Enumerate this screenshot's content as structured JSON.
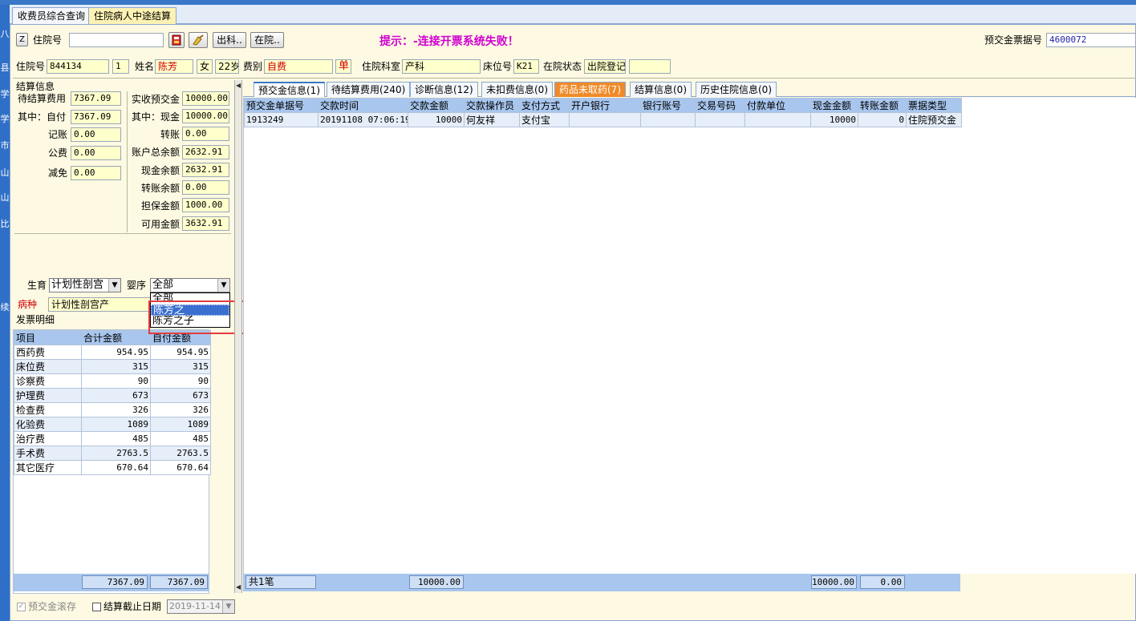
{
  "window_tabs": [
    "收费员综合查询",
    "住院病人中途结算"
  ],
  "left_strip": [
    "八",
    "县",
    "学",
    "学",
    "市",
    "山",
    "山",
    "比",
    "续"
  ],
  "search": {
    "z_label": "Z",
    "inpatient_label": "住院号",
    "inpatient_value": "",
    "discharge_btn": "出科..",
    "inhospital_btn": "在院..",
    "hint": "提示：-连接开票系统失败！",
    "prepay_receipt_label": "预交金票据号",
    "prepay_receipt_value": "4600072"
  },
  "patient": {
    "id_label": "住院号",
    "id_value": "844134",
    "seq": "1",
    "name_label": "姓名",
    "name": "陈芳",
    "sex": "女",
    "age": "22岁",
    "fee_type_label": "费别",
    "fee_type": "自费",
    "single_badge": "单",
    "dept_label": "住院科室",
    "dept": "产科",
    "bed_label": "床位号",
    "bed": "K21",
    "status_label": "在院状态",
    "status": "出院登记",
    "extra": ""
  },
  "settlement": {
    "title": "结算信息",
    "pending_fee_label": "待结算费用",
    "pending_fee": "7367.09",
    "self_pay_label": "其中：自付",
    "self_pay": "7367.09",
    "account_label": "记账",
    "account": "0.00",
    "public_label": "公费",
    "public": "0.00",
    "discount_label": "减免",
    "discount": "0.00",
    "received_prepay_label": "实收预交金",
    "received_prepay": "10000.00",
    "cash_label": "其中：现金",
    "cash": "10000.00",
    "transfer_label": "转账",
    "transfer": "0.00",
    "total_balance_label": "账户总余额",
    "total_balance": "2632.91",
    "cash_balance_label": "现金余额",
    "cash_balance": "2632.91",
    "transfer_balance_label": "转账余额",
    "transfer_balance": "0.00",
    "guarantee_label": "担保金额",
    "guarantee": "1000.00",
    "available_label": "可用金额",
    "available": "3632.91"
  },
  "birth": {
    "label": "生育",
    "value": "计划性剖宫",
    "baby_label": "婴序",
    "baby_value": "全部",
    "baby_options": [
      "全部",
      "陈芳之",
      "陈芳之子"
    ],
    "disease_label": "病种",
    "disease_value": "计划性剖宫产"
  },
  "invoice": {
    "title": "发票明细",
    "columns": [
      "项目",
      "合计金额",
      "自付金额"
    ],
    "rows": [
      [
        "西药费",
        "954.95",
        "954.95"
      ],
      [
        "床位费",
        "315",
        "315"
      ],
      [
        "诊察费",
        "90",
        "90"
      ],
      [
        "护理费",
        "673",
        "673"
      ],
      [
        "检查费",
        "326",
        "326"
      ],
      [
        "化验费",
        "1089",
        "1089"
      ],
      [
        "治疗费",
        "485",
        "485"
      ],
      [
        "手术费",
        "2763.5",
        "2763.5"
      ],
      [
        "其它医疗",
        "670.64",
        "670.64"
      ]
    ],
    "total": "7367.09",
    "self_total": "7367.09"
  },
  "subtabs": [
    "预交金信息(1)",
    "待结算费用(240)",
    "诊断信息(12)",
    "未扣费信息(0)",
    "药品未取药(7)",
    "结算信息(0)",
    "历史住院信息(0)"
  ],
  "prepay_table": {
    "columns": [
      "预交金单据号",
      "交款时间",
      "交款金额",
      "交款操作员",
      "支付方式",
      "开户银行",
      "银行账号",
      "交易号码",
      "付款单位",
      "现金金额",
      "转账金额",
      "票据类型"
    ],
    "rows": [
      [
        "1913249",
        "20191108 07:06:19",
        "10000",
        "何友祥",
        "支付宝",
        "",
        "",
        "",
        "",
        "10000",
        "0",
        "住院预交金"
      ]
    ],
    "footer_count": "共1笔",
    "footer_amount": "10000.00",
    "footer_cash": "10000.00",
    "footer_transfer": "0.00"
  },
  "bottom": {
    "prepay_store_label": "预交金滚存",
    "cutoff_label": "结算截止日期",
    "cutoff_date": "2019-11-14"
  }
}
